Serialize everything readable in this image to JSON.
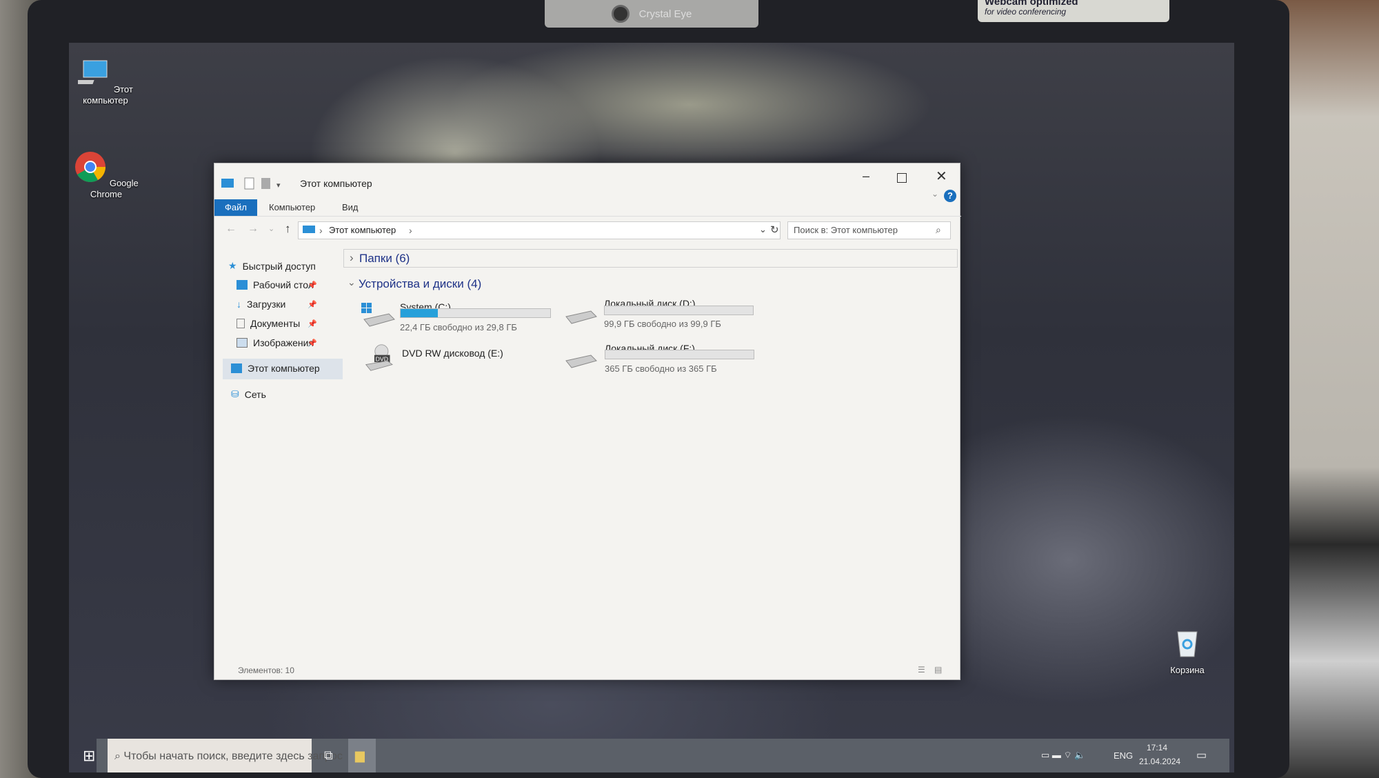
{
  "bezel": {
    "camera_label": "Crystal Eye",
    "sticker_title": "Webcam optimized",
    "sticker_subtitle": "for video conferencing"
  },
  "desktop": {
    "icons": [
      {
        "label": "Этот компьютер",
        "icon": "computer-icon"
      },
      {
        "label": "Google Chrome",
        "icon": "chrome-icon"
      },
      {
        "label": "Корзина",
        "icon": "recycle-bin-icon"
      }
    ]
  },
  "explorer": {
    "title": "Этот компьютер",
    "ribbon_tabs": [
      "Файл",
      "Компьютер",
      "Вид"
    ],
    "address": {
      "path": "Этот компьютер",
      "separator": "›"
    },
    "search_placeholder": "Поиск в: Этот компьютер",
    "nav": {
      "quick_access": "Быстрый доступ",
      "items": [
        {
          "label": "Рабочий стол",
          "pinned": true
        },
        {
          "label": "Загрузки",
          "pinned": true
        },
        {
          "label": "Документы",
          "pinned": true
        },
        {
          "label": "Изображения",
          "pinned": true
        }
      ],
      "this_pc": "Этот компьютер",
      "network": "Сеть"
    },
    "groups": {
      "folders": "Папки (6)",
      "devices": "Устройства и диски (4)"
    },
    "drives": [
      {
        "name": "System (C:)",
        "free_text": "22,4 ГБ свободно из 29,8 ГБ",
        "used_percent": 24.8
      },
      {
        "name": "Локальный диск (D:)",
        "free_text": "99,9 ГБ свободно из 99,9 ГБ",
        "used_percent": 0
      },
      {
        "name": "DVD RW дисковод (E:)",
        "badge": "DVD"
      },
      {
        "name": "Локальный диск (F:)",
        "free_text": "365 ГБ свободно из 365 ГБ",
        "used_percent": 0
      }
    ],
    "status": "Элементов: 10",
    "accent": "#26a0da"
  },
  "taskbar": {
    "search_placeholder": "Чтобы начать поиск, введите здесь запрос",
    "language": "ENG",
    "time": "17:14",
    "date": "21.04.2024"
  }
}
